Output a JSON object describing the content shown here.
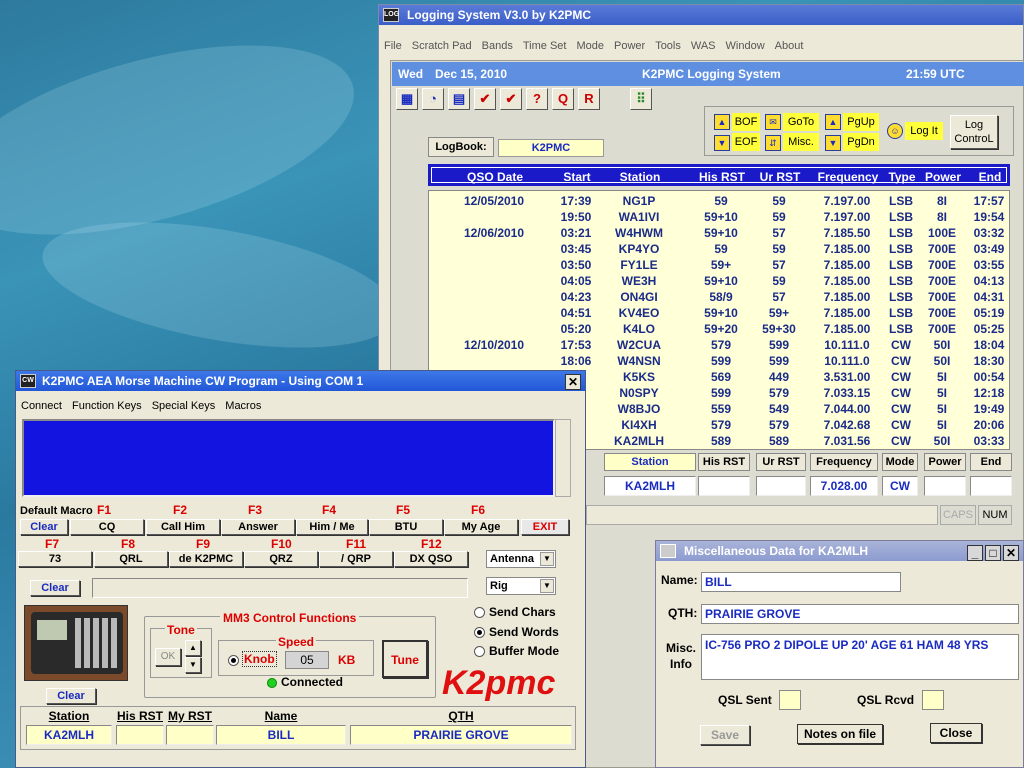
{
  "log_window": {
    "title": "Logging System V3.0 by K2PMC",
    "menu": [
      "File",
      "Scratch Pad",
      "Bands",
      "Time Set",
      "Mode",
      "Power",
      "Tools",
      "WAS",
      "Window",
      "About"
    ],
    "day": "Wed",
    "date": "Dec 15, 2010",
    "system_name": "K2PMC Logging System",
    "time": "21:59 UTC",
    "toolbar_icons": [
      "chart-icon",
      "clock-icon",
      "database-icon",
      "dx-checkmark-icon",
      "dx-check-icon",
      "help-icon",
      "query-icon",
      "record-icon",
      "traffic-light-icon"
    ],
    "toolbar_glyphs": [
      "▦",
      "◔",
      "▤",
      "✔",
      "✔",
      "?",
      "Q",
      "R",
      "⠿"
    ],
    "logbook_label": "LogBook:",
    "logbook_value": "K2PMC",
    "nav": {
      "bof": "BOF",
      "eof": "EOF",
      "goto": "GoTo",
      "misc": "Misc.",
      "pgup": "PgUp",
      "pgdn": "PgDn",
      "logit": "Log It",
      "logcontrol_1": "Log",
      "logcontrol_2": "ControL"
    },
    "columns": [
      "QSO Date",
      "Start",
      "Station",
      "His RST",
      "Ur RST",
      "Frequency",
      "Type",
      "Power",
      "End"
    ],
    "rows": [
      {
        "date": "12/05/2010",
        "start": "17:39",
        "station": "NG1P",
        "his": "59",
        "ur": "59",
        "freq": "7.197.00",
        "type": "LSB",
        "power": "8I",
        "end": "17:57"
      },
      {
        "date": "",
        "start": "19:50",
        "station": "WA1IVI",
        "his": "59+10",
        "ur": "59",
        "freq": "7.197.00",
        "type": "LSB",
        "power": "8I",
        "end": "19:54"
      },
      {
        "date": "12/06/2010",
        "start": "03:21",
        "station": "W4HWM",
        "his": "59+10",
        "ur": "57",
        "freq": "7.185.50",
        "type": "LSB",
        "power": "100E",
        "end": "03:32"
      },
      {
        "date": "",
        "start": "03:45",
        "station": "KP4YO",
        "his": "59",
        "ur": "59",
        "freq": "7.185.00",
        "type": "LSB",
        "power": "700E",
        "end": "03:49"
      },
      {
        "date": "",
        "start": "03:50",
        "station": "FY1LE",
        "his": "59+",
        "ur": "57",
        "freq": "7.185.00",
        "type": "LSB",
        "power": "700E",
        "end": "03:55"
      },
      {
        "date": "",
        "start": "04:05",
        "station": "WE3H",
        "his": "59+10",
        "ur": "59",
        "freq": "7.185.00",
        "type": "LSB",
        "power": "700E",
        "end": "04:13"
      },
      {
        "date": "",
        "start": "04:23",
        "station": "ON4GI",
        "his": "58/9",
        "ur": "57",
        "freq": "7.185.00",
        "type": "LSB",
        "power": "700E",
        "end": "04:31"
      },
      {
        "date": "",
        "start": "04:51",
        "station": "KV4EO",
        "his": "59+10",
        "ur": "59+",
        "freq": "7.185.00",
        "type": "LSB",
        "power": "700E",
        "end": "05:19"
      },
      {
        "date": "",
        "start": "05:20",
        "station": "K4LO",
        "his": "59+20",
        "ur": "59+30",
        "freq": "7.185.00",
        "type": "LSB",
        "power": "700E",
        "end": "05:25"
      },
      {
        "date": "12/10/2010",
        "start": "17:53",
        "station": "W2CUA",
        "his": "579",
        "ur": "599",
        "freq": "10.111.0",
        "type": "CW",
        "power": "50I",
        "end": "18:04"
      },
      {
        "date": "",
        "start": "18:06",
        "station": "W4NSN",
        "his": "599",
        "ur": "599",
        "freq": "10.111.0",
        "type": "CW",
        "power": "50I",
        "end": "18:30"
      },
      {
        "date": "",
        "start": "",
        "station": "K5KS",
        "his": "569",
        "ur": "449",
        "freq": "3.531.00",
        "type": "CW",
        "power": "5I",
        "end": "00:54"
      },
      {
        "date": "",
        "start": "",
        "station": "N0SPY",
        "his": "599",
        "ur": "579",
        "freq": "7.033.15",
        "type": "CW",
        "power": "5I",
        "end": "12:18"
      },
      {
        "date": "",
        "start": "",
        "station": "W8BJO",
        "his": "559",
        "ur": "549",
        "freq": "7.044.00",
        "type": "CW",
        "power": "5I",
        "end": "19:49"
      },
      {
        "date": "",
        "start": "",
        "station": "KI4XH",
        "his": "579",
        "ur": "579",
        "freq": "7.042.68",
        "type": "CW",
        "power": "5I",
        "end": "20:06"
      },
      {
        "date": "",
        "start": "",
        "station": "KA2MLH",
        "his": "589",
        "ur": "589",
        "freq": "7.031.56",
        "type": "CW",
        "power": "50I",
        "end": "03:33"
      }
    ],
    "entry_headers": [
      "Station",
      "His RST",
      "Ur RST",
      "Frequency",
      "Mode",
      "Power",
      "End"
    ],
    "entry_values": {
      "station": "KA2MLH",
      "his": "",
      "ur": "",
      "freq": "7.028.00",
      "mode": "CW",
      "power": "",
      "end": ""
    },
    "status": {
      "caps": "CAPS",
      "num": "NUM"
    }
  },
  "cw_window": {
    "title": "K2PMC AEA Morse Machine CW Program - Using COM  1",
    "menu": [
      "Connect",
      "Function Keys",
      "Special Keys",
      "Macros"
    ],
    "default_macro_label": "Default Macro",
    "clear": "Clear",
    "exit": "EXIT",
    "fkeys": [
      {
        "key": "F1",
        "label": "CQ"
      },
      {
        "key": "F2",
        "label": "Call Him"
      },
      {
        "key": "F3",
        "label": "Answer"
      },
      {
        "key": "F4",
        "label": "Him / Me"
      },
      {
        "key": "F5",
        "label": "BTU"
      },
      {
        "key": "F6",
        "label": "My Age"
      },
      {
        "key": "F7",
        "label": "73"
      },
      {
        "key": "F8",
        "label": "QRL"
      },
      {
        "key": "F9",
        "label": "de K2PMC"
      },
      {
        "key": "F10",
        "label": "QRZ"
      },
      {
        "key": "F11",
        "label": "/ QRP"
      },
      {
        "key": "F12",
        "label": "DX QSO"
      }
    ],
    "antenna": "Antenna",
    "rig": "Rig",
    "mm3_title": "MM3 Control Functions",
    "tone_label": "Tone",
    "tone_ok": "OK",
    "speed_label": "Speed",
    "knob_label": "Knob",
    "speed_value": "05",
    "speed_unit": "KB",
    "tune": "Tune",
    "connected": "Connected",
    "send_chars": "Send Chars",
    "send_words": "Send Words",
    "buffer_mode": "Buffer Mode",
    "logo": "K2pmc",
    "bottom_headers": [
      "Station",
      "His RST",
      "My RST",
      "Name",
      "QTH"
    ],
    "bottom_values": {
      "station": "KA2MLH",
      "his": "",
      "my": "",
      "name": "BILL",
      "qth": "PRAIRIE GROVE"
    },
    "colors": {
      "text_area": "#1414e0",
      "logo": "#e01010"
    }
  },
  "misc_window": {
    "title": "Miscellaneous Data for KA2MLH",
    "name_label": "Name:",
    "name": "BILL",
    "qth_label": "QTH:",
    "qth": "PRAIRIE GROVE",
    "misc_label_1": "Misc.",
    "misc_label_2": "Info",
    "misc": "IC-756 PRO 2 DIPOLE UP 20' AGE 61 HAM 48 YRS",
    "qsl_sent": "QSL Sent",
    "qsl_rcvd": "QSL Rcvd",
    "save": "Save",
    "notes": "Notes on file",
    "close": "Close"
  }
}
